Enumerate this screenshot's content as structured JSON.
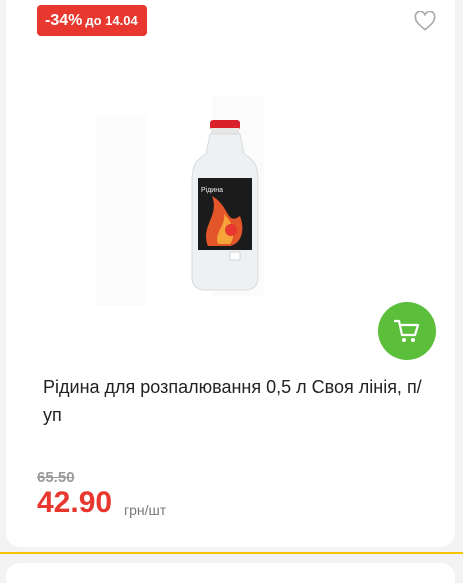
{
  "badge": {
    "discount": "-34%",
    "until": "до 14.04"
  },
  "product": {
    "title": "Рідина для розпалювання 0,5 л Своя лінія, п/уп",
    "bottle_label": "Рідина"
  },
  "price": {
    "old": "65.50",
    "new": "42.90",
    "unit": "грн/шт"
  },
  "icons": {
    "favorite": "heart-outline-icon",
    "cart": "cart-icon"
  },
  "colors": {
    "accent_red": "#e8372e",
    "cart_green": "#5cbf3b",
    "strip_yellow": "#f5c400"
  }
}
